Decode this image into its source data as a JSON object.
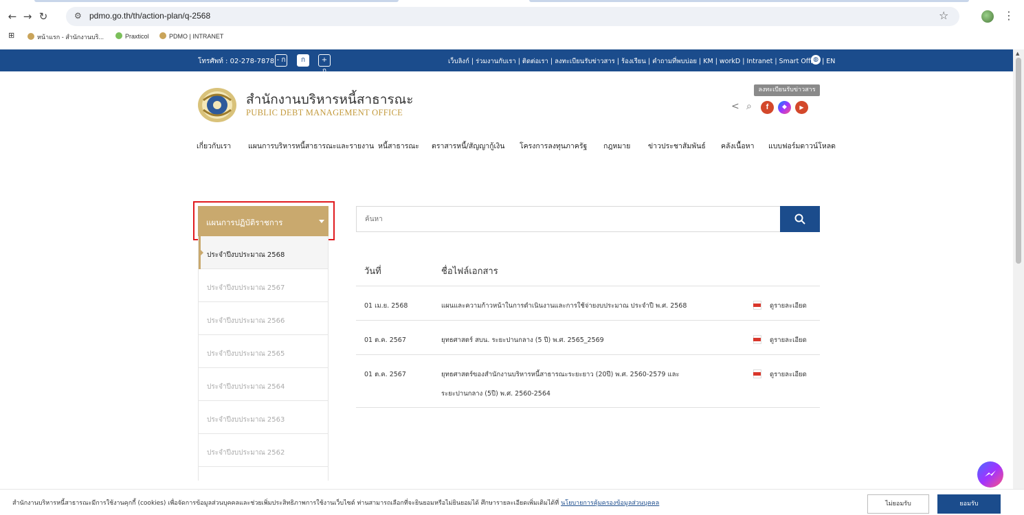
{
  "browser": {
    "url": "pdmo.go.th/th/action-plan/q-2568",
    "bookmarks": [
      "หน้าแรก - สำนักงานบริ...",
      "Praxticol",
      "PDMO | INTRANET"
    ]
  },
  "topbar": {
    "phone": "โทรศัพท์ : 02-278-7878",
    "font_small": "- ก",
    "font_normal": "ก",
    "font_large": "+ ก",
    "links": "เว็บลิงก์ | ร่วมงานกับเรา | ติดต่อเรา | ลงทะเบียนรับข่าวสาร | ร้องเรียน | คำถามที่พบบ่อย | KM | workD | Intranet | Smart Office | EN"
  },
  "header": {
    "org_name_th": "สำนักงานบริหารหนี้สาธารณะ",
    "org_name_en": "PUBLIC DEBT MANAGEMENT OFFICE",
    "subscribe_label": "ลงทะเบียนรับข่าวสาร"
  },
  "nav": {
    "items": [
      "เกี่ยวกับเรา",
      "แผนการบริหารหนี้สาธารณะและรายงาน",
      "หนี้สาธารณะ",
      "ตราสารหนี้/สัญญากู้เงิน",
      "โครงการลงทุนภาครัฐ",
      "กฎหมาย",
      "ข่าวประชาสัมพันธ์",
      "คลังเนื้อหา",
      "แบบฟอร์มดาวน์โหลด"
    ]
  },
  "sidebar": {
    "dropdown_label": "แผนการปฏิบัติราชการ",
    "items": [
      "ประจำปีงบประมาณ 2568",
      "ประจำปีงบประมาณ 2567",
      "ประจำปีงบประมาณ 2566",
      "ประจำปีงบประมาณ 2565",
      "ประจำปีงบประมาณ 2564",
      "ประจำปีงบประมาณ 2563",
      "ประจำปีงบประมาณ 2562"
    ]
  },
  "search": {
    "placeholder": "ค้นหา"
  },
  "table": {
    "col_date": "วันที่",
    "col_name": "ชื่อไฟล์เอกสาร",
    "rows": [
      {
        "date": "01 เม.ย. 2568",
        "name1": "แผนและความก้าวหน้าในการดำเนินงานและการใช้จ่ายงบประมาณ ประจำปี พ.ศ. 2568",
        "name2": "",
        "detail": "ดูรายละเอียด"
      },
      {
        "date": "01 ต.ค. 2567",
        "name1": "ยุทธศาสตร์ สบน. ระยะปานกลาง (5 ปี) พ.ศ. 2565_2569",
        "name2": "",
        "detail": "ดูรายละเอียด"
      },
      {
        "date": "01 ต.ค. 2567",
        "name1": "ยุทธศาสตร์ของสำนักงานบริหารหนี้สาธารณะระยะยาว (20ปี) พ.ศ. 2560-2579 และ",
        "name2": "ระยะปานกลาง (5ปี) พ.ศ. 2560-2564",
        "detail": "ดูรายละเอียด"
      }
    ]
  },
  "cookie": {
    "text": "สำนักงานบริหารหนี้สาธารณะมีการใช้งานคุกกี้ (cookies) เพื่อจัดการข้อมูลส่วนบุคคลและช่วยเพิ่มประสิทธิภาพการใช้งานเว็บไซต์ ท่านสามารถเลือกที่จะยินยอมหรือไม่ยินยอมได้ ศึกษารายละเอียดเพิ่มเติมได้ที่",
    "link": "นโยบายการคุ้มครองข้อมูลส่วนบุคคล",
    "decline": "ไม่ยอมรับ",
    "accept": "ยอมรับ"
  },
  "colors": {
    "primary": "#1b4c8c",
    "gold": "#c9a96e",
    "highlight": "#e0191d"
  }
}
